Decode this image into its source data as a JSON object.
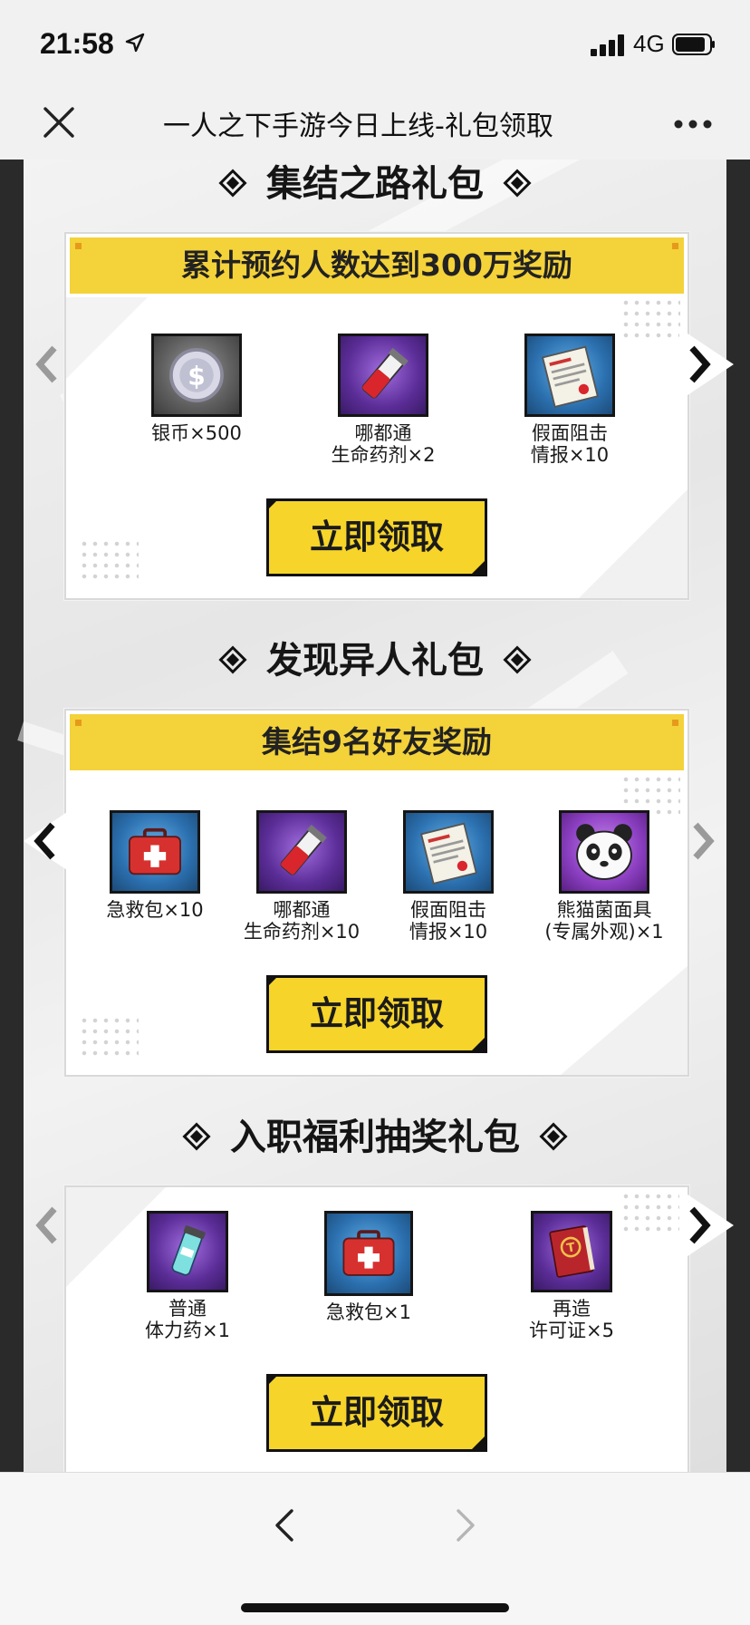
{
  "status_bar": {
    "time": "21:58",
    "network": "4G"
  },
  "nav": {
    "title": "一人之下手游今日上线-礼包领取"
  },
  "sections": [
    {
      "title": "集结之路礼包",
      "header": "累计预约人数达到300万奖励",
      "items": [
        {
          "line1": "银币×500",
          "line2": "",
          "icon": "silver-coin-icon"
        },
        {
          "line1": "哪都通",
          "line2": "生命药剂×2",
          "icon": "health-potion-icon"
        },
        {
          "line1": "假面阻击",
          "line2": "情报×10",
          "icon": "intel-document-icon"
        }
      ],
      "button": "立即领取"
    },
    {
      "title": "发现异人礼包",
      "header": "集结9名好友奖励",
      "items": [
        {
          "line1": "急救包×10",
          "line2": "",
          "icon": "first-aid-kit-icon"
        },
        {
          "line1": "哪都通",
          "line2": "生命药剂×10",
          "icon": "health-potion-icon"
        },
        {
          "line1": "假面阻击",
          "line2": "情报×10",
          "icon": "intel-document-icon"
        },
        {
          "line1": "熊猫菌面具",
          "line2": "(专属外观)×1",
          "icon": "panda-mask-icon"
        }
      ],
      "button": "立即领取"
    },
    {
      "title": "入职福利抽奖礼包",
      "header": "",
      "items": [
        {
          "line1": "普通",
          "line2": "体力药×1",
          "icon": "stamina-potion-icon"
        },
        {
          "line1": "急救包×1",
          "line2": "",
          "icon": "first-aid-kit-icon"
        },
        {
          "line1": "再造",
          "line2": "许可证×5",
          "icon": "license-book-icon"
        }
      ],
      "button": "立即领取"
    }
  ],
  "colors": {
    "accent_yellow": "#f6d42a",
    "header_yellow": "#f4d23a",
    "frame_dark": "#2a2a2a"
  }
}
